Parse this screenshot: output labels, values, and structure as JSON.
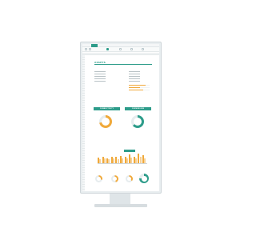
{
  "app": {
    "menu_tabs": [
      "",
      "",
      "",
      "",
      "",
      "",
      "",
      ""
    ],
    "accent_color": "#2d9c8a",
    "highlight_color": "#f0a93a"
  },
  "report": {
    "title": "ASSETS",
    "left_panel": {
      "heading": "",
      "rows": [
        "",
        "",
        "",
        "",
        ""
      ]
    },
    "right_panel": {
      "heading": "",
      "rows": [
        "",
        "",
        "",
        "",
        ""
      ]
    },
    "banners": [
      "CONNECTIVITY",
      "CONVERSION"
    ],
    "hbar_fractions": [
      0.8,
      0.55,
      0.7
    ],
    "donuts": [
      {
        "label": "",
        "fraction": 0.72,
        "color": "#f0a93a"
      },
      {
        "label": "",
        "fraction": 0.64,
        "color": "#2d9c8a"
      }
    ],
    "bar_section": {
      "label": "",
      "tag": "",
      "values_a": [
        0.55,
        0.6,
        0.5,
        0.62,
        0.58,
        0.7,
        0.65,
        0.85,
        0.6,
        0.9,
        0.75
      ],
      "values_b": [
        0.4,
        0.45,
        0.35,
        0.5,
        0.42,
        0.5,
        0.48,
        0.55,
        0.45,
        0.6,
        0.5
      ]
    },
    "small_section": {
      "label": "",
      "donuts": [
        {
          "fraction": 0.3,
          "color": "#f0a93a"
        },
        {
          "fraction": 0.45,
          "color": "#f0a93a"
        },
        {
          "fraction": 0.35,
          "color": "#f0a93a"
        },
        {
          "fraction": 0.75,
          "color": "#2d9c8a"
        }
      ]
    }
  }
}
